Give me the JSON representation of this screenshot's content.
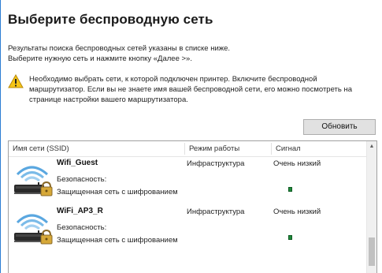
{
  "title": "Выберите беспроводную сеть",
  "description": {
    "line1": "Результаты поиска беспроводных сетей указаны в списке ниже.",
    "line2": "Выберите нужную сеть и нажмите кнопку «Далее >»."
  },
  "warning": {
    "icon": "warning-triangle-icon",
    "line1": "Необходимо выбрать сети, к которой подключен принтер. Включите беспроводной",
    "line2": "маршрутизатор. Если вы не знаете имя вашей беспроводной сети, его можно посмотреть на",
    "line3": "странице настройки вашего маршрутизатора."
  },
  "refresh_label": "Обновить",
  "list": {
    "columns": {
      "ssid": "Имя сети (SSID)",
      "mode": "Режим работы",
      "signal": "Сигнал"
    },
    "rows": [
      {
        "ssid": "Wifi_Guest",
        "security_label": "Безопасность:",
        "security_value": "Защищенная сеть с шифрованием",
        "mode": "Инфраструктура",
        "signal": "Очень низкий"
      },
      {
        "ssid": "WiFi_AP3_R",
        "security_label": "Безопасность:",
        "security_value": "Защищенная сеть с шифрованием",
        "mode": "Инфраструктура",
        "signal": "Очень низкий"
      }
    ]
  },
  "colors": {
    "accent": "#2b7cd3",
    "signal_green": "#1f8a3a",
    "warning_yellow": "#f5c518"
  }
}
